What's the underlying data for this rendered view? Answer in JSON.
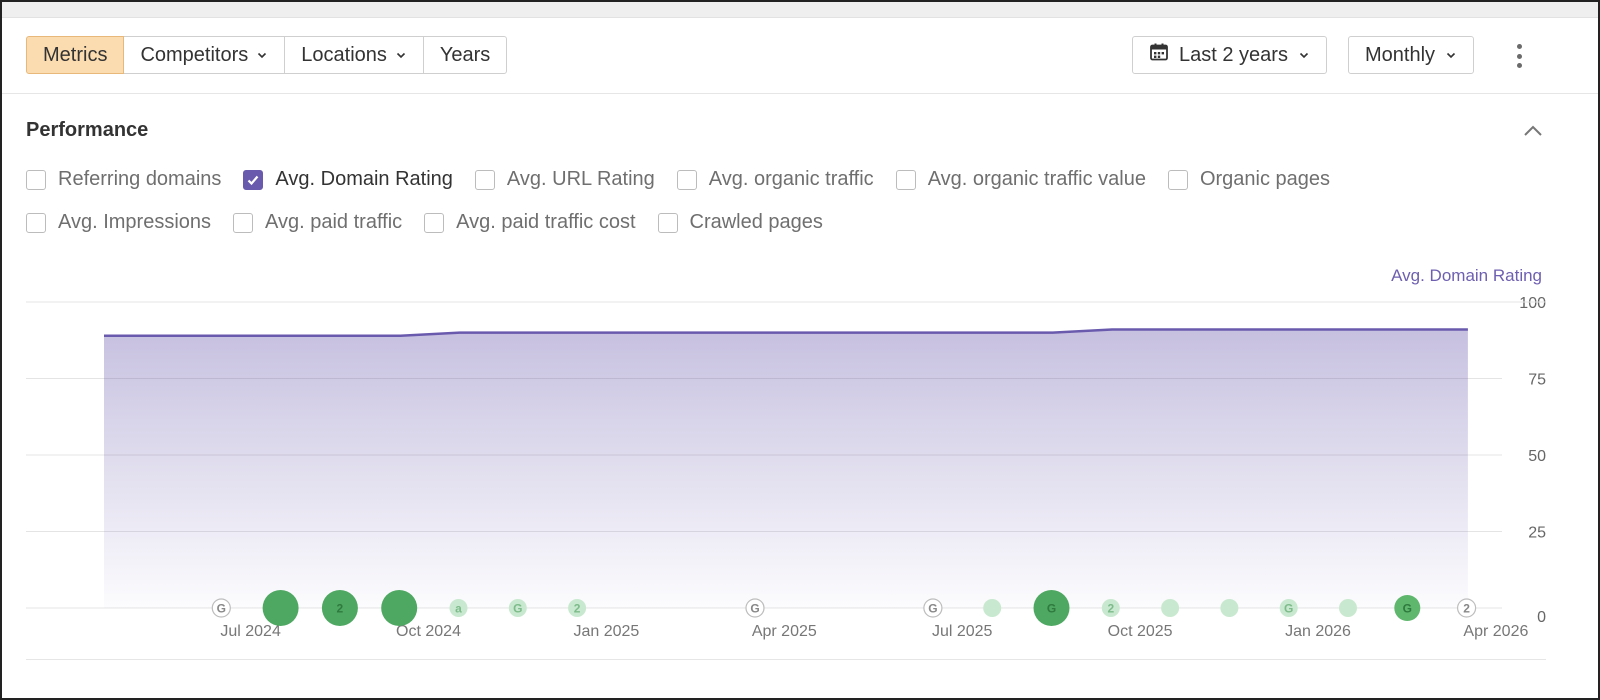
{
  "toolbar": {
    "tabs": [
      {
        "label": "Metrics",
        "active": true,
        "dropdown": false
      },
      {
        "label": "Competitors",
        "active": false,
        "dropdown": true
      },
      {
        "label": "Locations",
        "active": false,
        "dropdown": true
      },
      {
        "label": "Years",
        "active": false,
        "dropdown": false
      }
    ],
    "date_range": {
      "label": "Last 2 years",
      "icon": "calendar-icon"
    },
    "frequency": {
      "label": "Monthly"
    },
    "more_icon": "kebab-menu-icon"
  },
  "section": {
    "title": "Performance",
    "collapse_icon": "chevron-up-icon"
  },
  "metrics": {
    "row1": [
      {
        "label": "Referring domains",
        "checked": false
      },
      {
        "label": "Avg. Domain Rating",
        "checked": true
      },
      {
        "label": "Avg. URL Rating",
        "checked": false
      },
      {
        "label": "Avg. organic traffic",
        "checked": false
      },
      {
        "label": "Avg. organic traffic value",
        "checked": false
      },
      {
        "label": "Organic pages",
        "checked": false
      }
    ],
    "row2": [
      {
        "label": "Avg. Impressions",
        "checked": false
      },
      {
        "label": "Avg. paid traffic",
        "checked": false
      },
      {
        "label": "Avg. paid traffic cost",
        "checked": false
      },
      {
        "label": "Crawled pages",
        "checked": false
      }
    ]
  },
  "colors": {
    "accent": "#6a5aad",
    "active_tab_bg": "#fbdcb0",
    "series_line": "#6a5aad",
    "update_marker": "#4caf62"
  },
  "chart_data": {
    "type": "area",
    "series": [
      {
        "name": "Avg. Domain Rating",
        "x": [
          "2024-05",
          "2024-06",
          "2024-07",
          "2024-08",
          "2024-09",
          "2024-10",
          "2024-11",
          "2024-12",
          "2025-01",
          "2025-02",
          "2025-03",
          "2025-04",
          "2025-05",
          "2025-06",
          "2025-07",
          "2025-08",
          "2025-09",
          "2025-10",
          "2025-11",
          "2025-12",
          "2026-01",
          "2026-02",
          "2026-03",
          "2026-04"
        ],
        "values": [
          89,
          89,
          89,
          89,
          89,
          89,
          90,
          90,
          90,
          90,
          90,
          90,
          90,
          90,
          90,
          90,
          90,
          91,
          91,
          91,
          91,
          91,
          91,
          91
        ]
      }
    ],
    "x_ticks": [
      {
        "date": "2024-07",
        "label": "Jul 2024"
      },
      {
        "date": "2024-10",
        "label": "Oct 2024"
      },
      {
        "date": "2025-01",
        "label": "Jan 2025"
      },
      {
        "date": "2025-04",
        "label": "Apr 2025"
      },
      {
        "date": "2025-07",
        "label": "Jul 2025"
      },
      {
        "date": "2025-10",
        "label": "Oct 2025"
      },
      {
        "date": "2026-01",
        "label": "Jan 2026"
      },
      {
        "date": "2026-04",
        "label": "Apr 2026"
      }
    ],
    "y_ticks": [
      "100",
      "75",
      "50",
      "25",
      "0"
    ],
    "ylim": [
      0,
      100
    ],
    "y_axis_label": "Avg. Domain Rating",
    "grid": true,
    "update_markers": [
      {
        "date": "2024-06",
        "label": "G",
        "size": "small",
        "style": "outline"
      },
      {
        "date": "2024-07",
        "label": "",
        "size": "large",
        "style": "solid"
      },
      {
        "date": "2024-08",
        "label": "2",
        "size": "large",
        "style": "solid"
      },
      {
        "date": "2024-09",
        "label": "",
        "size": "large",
        "style": "solid"
      },
      {
        "date": "2024-10",
        "label": "a",
        "size": "small",
        "style": "light"
      },
      {
        "date": "2024-11",
        "label": "G",
        "size": "small",
        "style": "light"
      },
      {
        "date": "2024-12",
        "label": "2",
        "size": "small",
        "style": "light"
      },
      {
        "date": "2025-03",
        "label": "G",
        "size": "small",
        "style": "outline"
      },
      {
        "date": "2025-06",
        "label": "G",
        "size": "small",
        "style": "outline"
      },
      {
        "date": "2025-07",
        "label": "",
        "size": "small",
        "style": "light"
      },
      {
        "date": "2025-08",
        "label": "G",
        "size": "large",
        "style": "solid"
      },
      {
        "date": "2025-09",
        "label": "2",
        "size": "small",
        "style": "light"
      },
      {
        "date": "2025-10",
        "label": "",
        "size": "small",
        "style": "light"
      },
      {
        "date": "2025-11",
        "label": "",
        "size": "small",
        "style": "light"
      },
      {
        "date": "2025-12",
        "label": "G",
        "size": "small",
        "style": "light"
      },
      {
        "date": "2026-01",
        "label": "",
        "size": "small",
        "style": "light"
      },
      {
        "date": "2026-02",
        "label": "G",
        "size": "medium",
        "style": "solid"
      },
      {
        "date": "2026-03",
        "label": "2",
        "size": "small",
        "style": "outline"
      }
    ]
  }
}
